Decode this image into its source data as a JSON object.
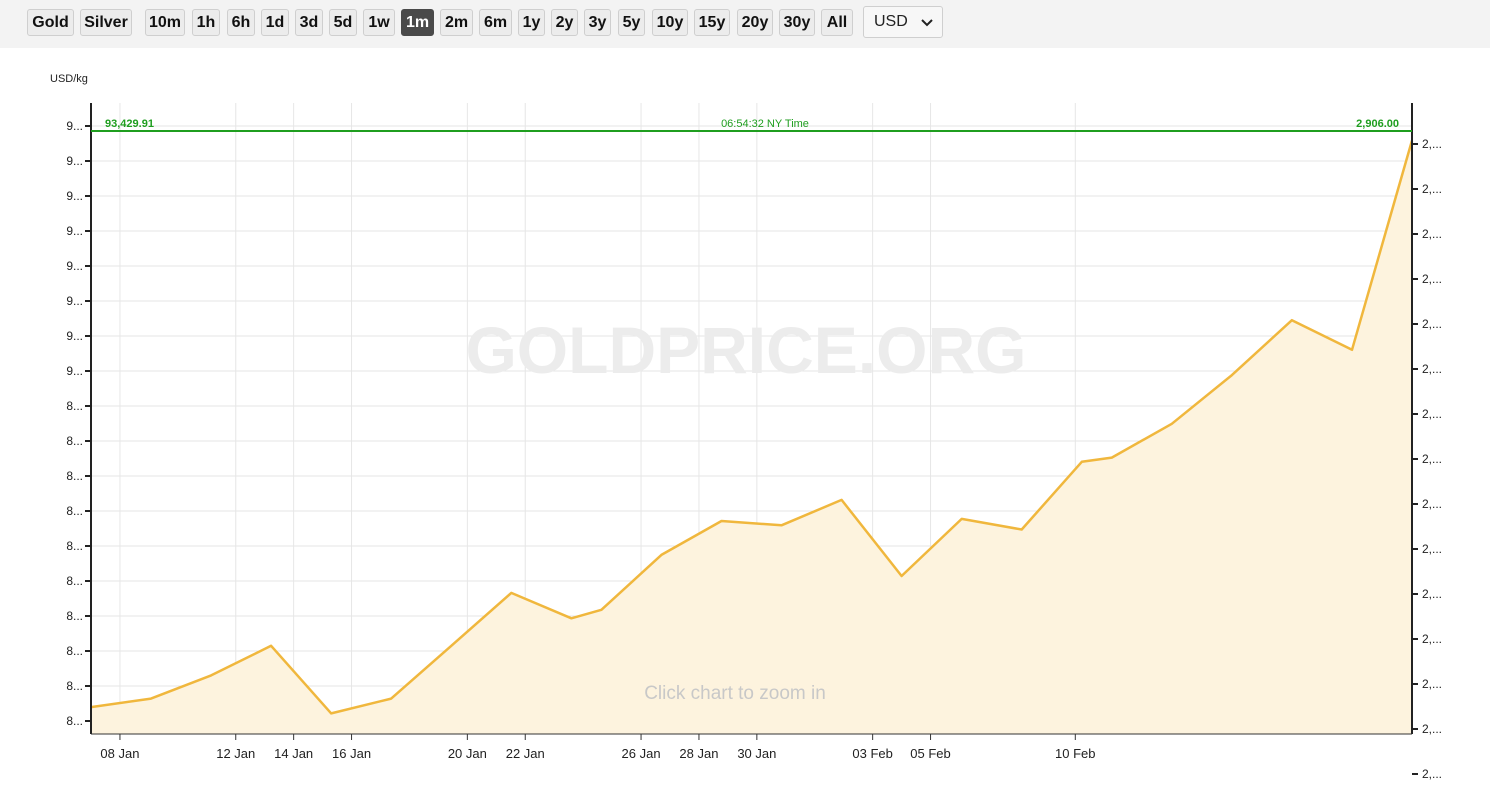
{
  "toolbar": {
    "metals": [
      {
        "label": "Gold",
        "active": true
      },
      {
        "label": "Silver",
        "active": false
      }
    ],
    "ranges": [
      {
        "label": "10m",
        "active": false
      },
      {
        "label": "1h",
        "active": false
      },
      {
        "label": "6h",
        "active": false
      },
      {
        "label": "1d",
        "active": false
      },
      {
        "label": "3d",
        "active": false
      },
      {
        "label": "5d",
        "active": false
      },
      {
        "label": "1w",
        "active": false
      },
      {
        "label": "1m",
        "active": true
      },
      {
        "label": "2m",
        "active": false
      },
      {
        "label": "6m",
        "active": false
      },
      {
        "label": "1y",
        "active": false
      },
      {
        "label": "2y",
        "active": false
      },
      {
        "label": "3y",
        "active": false
      },
      {
        "label": "5y",
        "active": false
      },
      {
        "label": "10y",
        "active": false
      },
      {
        "label": "15y",
        "active": false
      },
      {
        "label": "20y",
        "active": false
      },
      {
        "label": "30y",
        "active": false
      },
      {
        "label": "All",
        "active": false
      }
    ],
    "currency": "USD"
  },
  "chart_data": {
    "type": "area",
    "title": "",
    "ylabel": "USD/kg",
    "xlabel": "",
    "watermark": "GOLDPRICE.ORG",
    "zoom_hint": "Click chart to zoom in",
    "current_line": {
      "left_value": "93,429.91",
      "time_label": "06:54:32 NY Time",
      "right_value": "2,906.00"
    },
    "x_tick_labels": [
      "08 Jan",
      "12 Jan",
      "14 Jan",
      "16 Jan",
      "20 Jan",
      "22 Jan",
      "26 Jan",
      "28 Jan",
      "30 Jan",
      "03 Feb",
      "05 Feb",
      "10 Feb"
    ],
    "left_tick_labels": [
      "9...",
      "9...",
      "9...",
      "9...",
      "9...",
      "9...",
      "9...",
      "9...",
      "8...",
      "8...",
      "8...",
      "8...",
      "8...",
      "8...",
      "8...",
      "8...",
      "8...",
      "8..."
    ],
    "right_tick_labels": [
      "2,...",
      "2,...",
      "2,...",
      "2,...",
      "2,...",
      "2,...",
      "2,...",
      "2,...",
      "2,...",
      "2,...",
      "2,...",
      "2,...",
      "2,...",
      "2,...",
      "2,..."
    ],
    "series": [
      {
        "values": [
          2638,
          2642,
          2653,
          2667,
          2635,
          2642,
          2667,
          2692,
          2680,
          2684,
          2710,
          2726,
          2724,
          2736,
          2700,
          2727,
          2722,
          2754,
          2756,
          2772,
          2795,
          2821,
          2807,
          2906
        ]
      }
    ],
    "color": "#f0b73d",
    "fill": "#fdf3de",
    "current_line_color": "#1f9e1f",
    "grid": true
  }
}
